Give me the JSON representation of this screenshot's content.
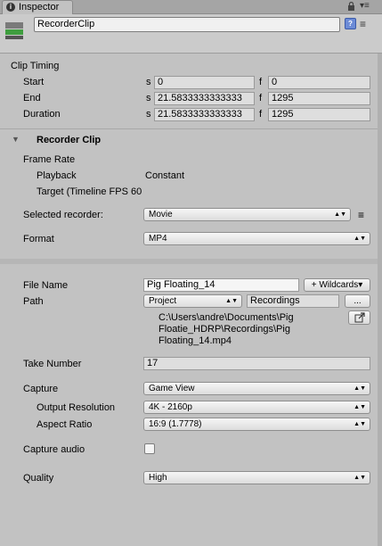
{
  "window": {
    "tab_title": "Inspector",
    "menu_glyph": "▾≡"
  },
  "header": {
    "object_name": "RecorderClip",
    "help_glyph": "?",
    "settings_glyph": "≡"
  },
  "clip_timing": {
    "heading": "Clip Timing",
    "start": {
      "label": "Start",
      "s_unit": "s",
      "s_value": "0",
      "f_unit": "f",
      "f_value": "0"
    },
    "end": {
      "label": "End",
      "s_unit": "s",
      "s_value": "21.5833333333333",
      "f_unit": "f",
      "f_value": "1295"
    },
    "duration": {
      "label": "Duration",
      "s_unit": "s",
      "s_value": "21.5833333333333",
      "f_unit": "f",
      "f_value": "1295"
    }
  },
  "recorder_clip": {
    "foldout_glyph": "▼",
    "heading": "Recorder Clip",
    "frame_rate_label": "Frame Rate",
    "playback_label": "Playback",
    "playback_value": "Constant",
    "target_label": "Target (Timeline FPS 60",
    "selected_recorder_label": "Selected recorder:",
    "selected_recorder_value": "Movie",
    "format_label": "Format",
    "format_value": "MP4"
  },
  "output": {
    "file_name_label": "File Name",
    "file_name_value": "Pig Floating_14",
    "wildcards_label": "+ Wildcards▾",
    "path_label": "Path",
    "path_root_value": "Project",
    "path_folder_value": "Recordings",
    "browse_label": "...",
    "resolved_path_line1": "C:\\Users\\andre\\Documents\\Pig",
    "resolved_path_line2": "Floatie_HDRP\\Recordings\\Pig",
    "resolved_path_line3": "Floating_14.mp4",
    "take_number_label": "Take Number",
    "take_number_value": "17"
  },
  "capture": {
    "capture_label": "Capture",
    "capture_value": "Game View",
    "output_resolution_label": "Output Resolution",
    "output_resolution_value": "4K - 2160p",
    "aspect_ratio_label": "Aspect Ratio",
    "aspect_ratio_value": "16:9 (1.7778)",
    "capture_audio_label": "Capture audio",
    "capture_audio_checked": false,
    "quality_label": "Quality",
    "quality_value": "High"
  },
  "dropdown_arrow": "▲▼"
}
